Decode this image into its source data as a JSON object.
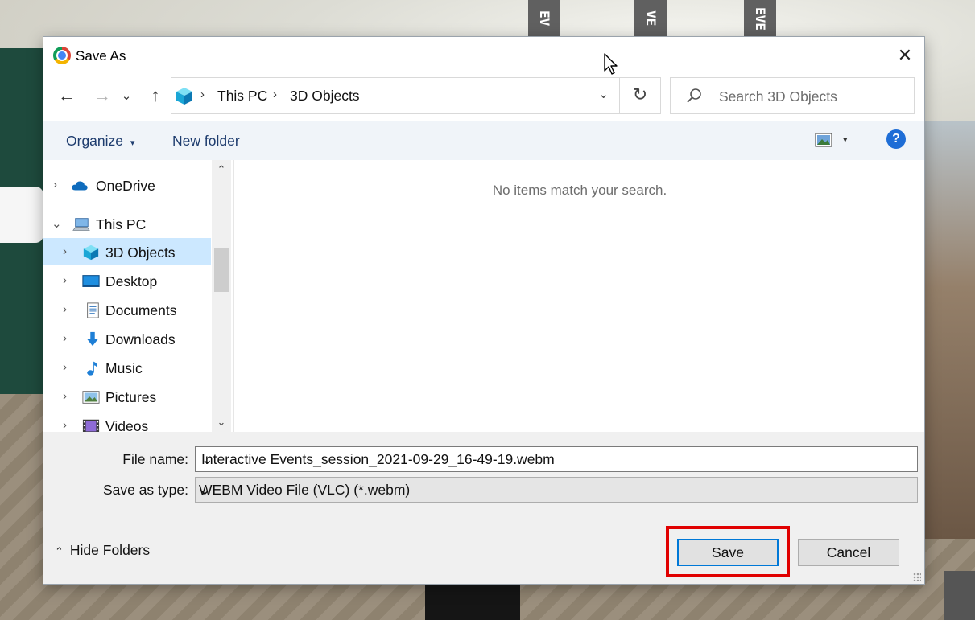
{
  "window": {
    "title": "Save As",
    "close_glyph": "✕"
  },
  "background": {
    "signs": [
      "EV",
      "VE",
      "EVE"
    ]
  },
  "nav": {
    "back_glyph": "←",
    "forward_glyph": "→",
    "recent_glyph": "⌄",
    "up_glyph": "↑",
    "breadcrumbs": [
      "This PC",
      "3D Objects"
    ],
    "separator": "›",
    "dropdown_glyph": "⌄",
    "refresh_glyph": "↻"
  },
  "search": {
    "placeholder": "Search 3D Objects"
  },
  "toolbar": {
    "organize_label": "Organize",
    "organize_caret": "▾",
    "new_folder_label": "New folder",
    "view_caret": "▾",
    "help_label": "?"
  },
  "sidebar": {
    "items": [
      {
        "label": "OneDrive",
        "icon": "cloud-icon",
        "chevron": "›"
      },
      {
        "label": "This PC",
        "icon": "computer-icon",
        "chevron": "⌄"
      },
      {
        "label": "3D Objects",
        "icon": "cube-icon",
        "chevron": "›",
        "selected": true
      },
      {
        "label": "Desktop",
        "icon": "desktop-icon",
        "chevron": "›"
      },
      {
        "label": "Documents",
        "icon": "documents-icon",
        "chevron": "›"
      },
      {
        "label": "Downloads",
        "icon": "download-icon",
        "chevron": "›"
      },
      {
        "label": "Music",
        "icon": "music-icon",
        "chevron": "›"
      },
      {
        "label": "Pictures",
        "icon": "pictures-icon",
        "chevron": "›"
      },
      {
        "label": "Videos",
        "icon": "videos-icon",
        "chevron": "›"
      }
    ],
    "scroll_up": "⌃",
    "scroll_down": "⌄"
  },
  "content": {
    "empty_message": "No items match your search."
  },
  "form": {
    "filename_label": "File name:",
    "filename_value": "Interactive Events_session_2021-09-29_16-49-19.webm",
    "savetype_label": "Save as type:",
    "savetype_value": "WEBM Video File (VLC) (*.webm)",
    "dropdown_glyph": "⌄"
  },
  "footer": {
    "hide_folders_caret": "⌃",
    "hide_folders_label": "Hide Folders",
    "save_label": "Save",
    "cancel_label": "Cancel"
  },
  "colors": {
    "accent": "#0078d7",
    "highlight": "#e00000",
    "selection": "#cce8ff",
    "link": "#1e3c6e"
  }
}
